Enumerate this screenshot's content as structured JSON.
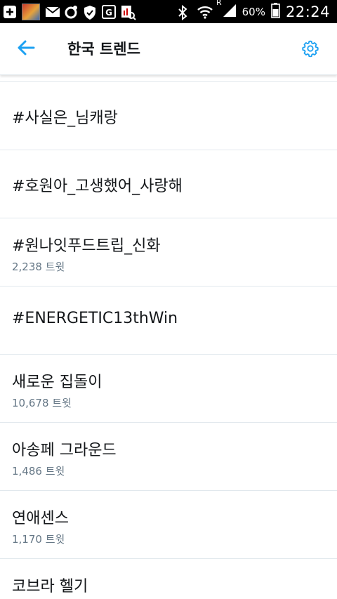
{
  "status_bar": {
    "battery_percent": "60%",
    "time": "22:24",
    "signal_label": "R",
    "left_icons": [
      "add-icon",
      "app-thumbnail",
      "mail-icon",
      "circle-app-icon",
      "shield-icon",
      "gps-icon",
      "image-search-icon"
    ],
    "right_icons": [
      "bluetooth-icon",
      "wifi-icon",
      "signal-icon",
      "battery-icon"
    ]
  },
  "header": {
    "title": "한국 트렌드",
    "back_icon": "arrow-left-icon",
    "settings_icon": "gear-icon",
    "accent_color": "#1da1f2"
  },
  "trends": [
    {
      "name": "#사실은_님캐랑",
      "count": ""
    },
    {
      "name": "#호원아_고생했어_사랑해",
      "count": ""
    },
    {
      "name": "#원나잇푸드트립_신화",
      "count": "2,238 트윗"
    },
    {
      "name": "#ENERGETIC13thWin",
      "count": ""
    },
    {
      "name": "새로운 집돌이",
      "count": "10,678 트윗"
    },
    {
      "name": "아송페 그라운드",
      "count": "1,486 트윗"
    },
    {
      "name": "연애센스",
      "count": "1,170 트윗"
    },
    {
      "name": "코브라 헬기",
      "count": ""
    }
  ]
}
